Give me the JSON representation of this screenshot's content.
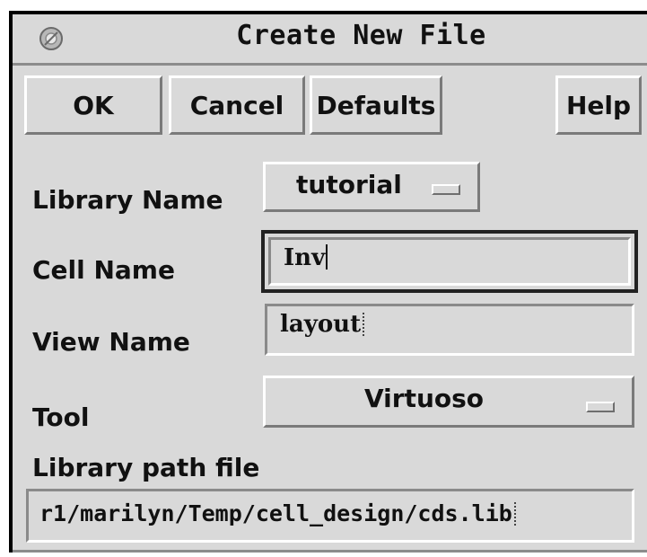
{
  "window": {
    "title": "Create New File"
  },
  "buttons": {
    "ok": "OK",
    "cancel": "Cancel",
    "defaults": "Defaults",
    "help": "Help"
  },
  "form": {
    "library_name_label": "Library Name",
    "library_name_value": "tutorial",
    "cell_name_label": "Cell Name",
    "cell_name_value": "Inv",
    "view_name_label": "View Name",
    "view_name_value": "layout",
    "tool_label": "Tool",
    "tool_value": "Virtuoso",
    "library_path_label": "Library path file",
    "library_path_value": "r1/marilyn/Temp/cell_design/cds.lib"
  },
  "icons": {
    "window_menu": "window-menu-icon",
    "option_indicator": "option-menu-indicator-icon"
  },
  "colors": {
    "background": "#d9d9d9",
    "text": "#111111",
    "focus_border": "#222222"
  }
}
